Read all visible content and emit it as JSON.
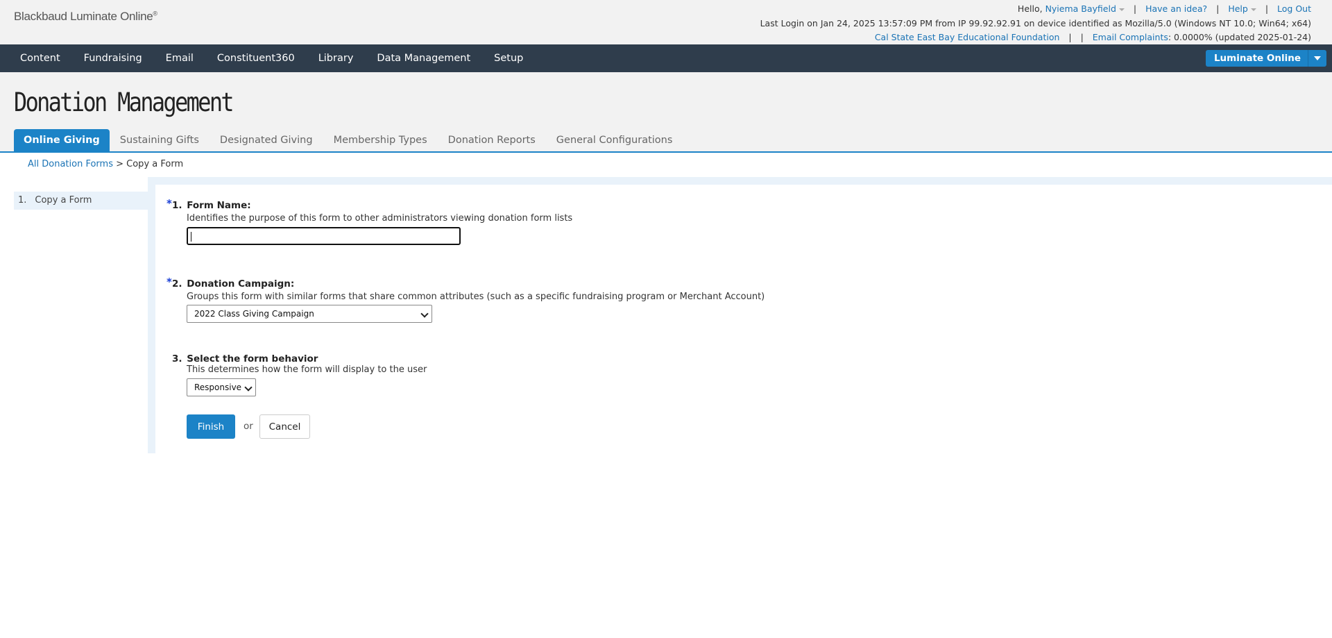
{
  "header": {
    "logo_text": "Blackbaud Luminate Online",
    "logo_mark": "®",
    "greeting": "Hello, ",
    "user_name": "Nyiema Bayfield",
    "have_idea": "Have an idea?",
    "help": "Help",
    "logout": "Log Out",
    "last_login": "Last Login on Jan 24, 2025 13:57:09 PM from IP 99.92.92.91 on device identified as Mozilla/5.0 (Windows NT 10.0; Win64; x64)",
    "org_name": "Cal State East Bay Educational Foundation",
    "email_complaints_label": "Email Complaints",
    "email_complaints_value": ": 0.0000% (updated 2025-01-24)"
  },
  "nav": {
    "items": [
      "Content",
      "Fundraising",
      "Email",
      "Constituent360",
      "Library",
      "Data Management",
      "Setup"
    ],
    "product_button": "Luminate Online"
  },
  "page": {
    "title": "Donation Management",
    "tabs": [
      "Online Giving",
      "Sustaining Gifts",
      "Designated Giving",
      "Membership Types",
      "Donation Reports",
      "General Configurations"
    ],
    "active_tab": "Online Giving"
  },
  "breadcrumb": {
    "link": "All Donation Forms",
    "separator": " > ",
    "current": "Copy a Form"
  },
  "sidebar": {
    "items": [
      {
        "num": "1.",
        "label": "Copy a Form"
      }
    ]
  },
  "form": {
    "required_mark": "*",
    "q1": {
      "number": "1.",
      "label": "Form Name:",
      "help": "Identifies the purpose of this form to other administrators viewing donation form lists",
      "value": ""
    },
    "q2": {
      "number": "2.",
      "label": "Donation Campaign:",
      "help": "Groups this form with similar forms that share common attributes (such as a specific fundraising program or Merchant Account)",
      "selected": "2022 Class Giving Campaign"
    },
    "q3": {
      "number": "3.",
      "label": "Select the form behavior",
      "help": "This determines how the form will display to the user",
      "selected": "Responsive"
    },
    "finish": "Finish",
    "or": "or",
    "cancel": "Cancel"
  },
  "colors": {
    "accent": "#1c83c7",
    "nav_bg": "#2f3d4c",
    "link": "#1a73b5",
    "required": "#1a3fd6"
  }
}
